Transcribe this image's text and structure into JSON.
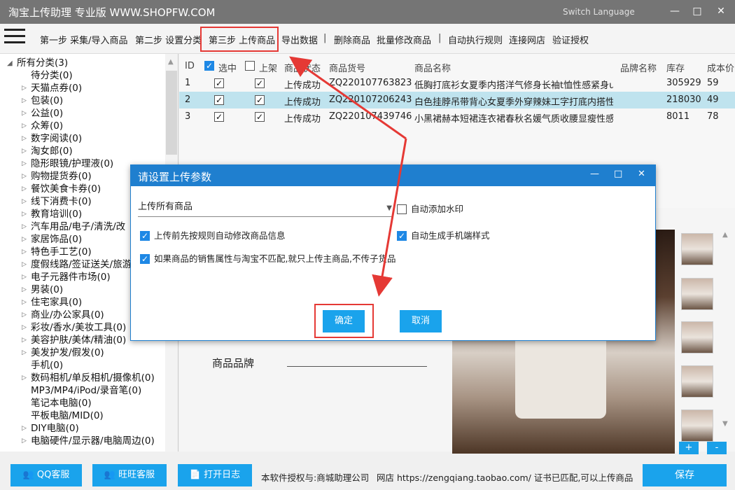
{
  "window": {
    "title": "淘宝上传助理 专业版 WWW.SHOPFW.COM",
    "language_label": "Switch Language",
    "minimize": "—",
    "maximize": "□",
    "close": "✕"
  },
  "menu": {
    "items": [
      "第一步 采集/导入商品",
      "第二步 设置分类",
      "第三步 上传商品",
      "导出数据",
      "|",
      "删除商品",
      "批量修改商品",
      "|",
      "自动执行规则",
      "连接网店",
      "验证授权"
    ]
  },
  "tree": {
    "root": "所有分类(3)",
    "items": [
      {
        "label": "待分类(0)",
        "arrow": false
      },
      {
        "label": "天猫点券(0)",
        "arrow": true
      },
      {
        "label": "包装(0)",
        "arrow": true
      },
      {
        "label": "公益(0)",
        "arrow": true
      },
      {
        "label": "众筹(0)",
        "arrow": true
      },
      {
        "label": "数字阅读(0)",
        "arrow": true
      },
      {
        "label": "淘女郎(0)",
        "arrow": true
      },
      {
        "label": "隐形眼镜/护理液(0)",
        "arrow": true
      },
      {
        "label": "购物提货券(0)",
        "arrow": true
      },
      {
        "label": "餐饮美食卡券(0)",
        "arrow": true
      },
      {
        "label": "线下消费卡(0)",
        "arrow": true
      },
      {
        "label": "教育培训(0)",
        "arrow": true
      },
      {
        "label": "汽车用品/电子/清洗/改",
        "arrow": true
      },
      {
        "label": "家居饰品(0)",
        "arrow": true
      },
      {
        "label": "特色手工艺(0)",
        "arrow": true
      },
      {
        "label": "度假线路/签证送关/旅游",
        "arrow": true
      },
      {
        "label": "电子元器件市场(0)",
        "arrow": true
      },
      {
        "label": "男装(0)",
        "arrow": true
      },
      {
        "label": "住宅家具(0)",
        "arrow": true
      },
      {
        "label": "商业/办公家具(0)",
        "arrow": true
      },
      {
        "label": "彩妆/香水/美妆工具(0)",
        "arrow": true
      },
      {
        "label": "美容护肤/美体/精油(0)",
        "arrow": true
      },
      {
        "label": "美发护发/假发(0)",
        "arrow": true
      },
      {
        "label": "手机(0)",
        "arrow": false
      },
      {
        "label": "数码相机/单反相机/摄像机(0)",
        "arrow": true
      },
      {
        "label": "MP3/MP4/iPod/录音笔(0)",
        "arrow": false
      },
      {
        "label": "笔记本电脑(0)",
        "arrow": false
      },
      {
        "label": "平板电脑/MID(0)",
        "arrow": false
      },
      {
        "label": "DIY电脑(0)",
        "arrow": true
      },
      {
        "label": "电脑硬件/显示器/电脑周边(0)",
        "arrow": true
      }
    ]
  },
  "grid": {
    "headers": {
      "id": "ID",
      "selected": "选中",
      "listed": "上架",
      "status": "商品状态",
      "sku": "商品货号",
      "name": "商品名称",
      "brand": "品牌名称",
      "stock": "库存",
      "cost": "成本价"
    },
    "rows": [
      {
        "id": "1",
        "status": "上传成功",
        "sku": "ZQ220107763823",
        "name": "低胸打底衫女夏季内搭洋气修身长袖t恤性感紧身u",
        "brand": "",
        "stock": "305929",
        "cost": "59"
      },
      {
        "id": "2",
        "status": "上传成功",
        "sku": "ZQ220107206243",
        "name": "白色挂脖吊带背心女夏季外穿辣妹工字打底内搭性",
        "brand": "",
        "stock": "218030",
        "cost": "49"
      },
      {
        "id": "3",
        "status": "上传成功",
        "sku": "ZQ220107439746",
        "name": "小黑裙赫本短裙连衣裙春秋名媛气质收腰显瘦性感",
        "brand": "",
        "stock": "8011",
        "cost": "78"
      }
    ]
  },
  "detail": {
    "brand_label": "商品品牌",
    "add_button": "+",
    "remove_button": "-"
  },
  "dialog": {
    "title": "请设置上传参数",
    "select_value": "上传所有商品",
    "opt_watermark": "自动添加水印",
    "opt_rule_modify": "上传前先按规则自动修改商品信息",
    "opt_mobile": "自动生成手机端样式",
    "opt_main_only": "如果商品的销售属性与淘宝不匹配,就只上传主商品,不传子货品",
    "ok": "确定",
    "cancel": "取消"
  },
  "bottom": {
    "qq": "QQ客服",
    "wangwang": "旺旺客服",
    "log": "打开日志",
    "license": "本软件授权与:商城助理公司",
    "shop": "网店 https://zengqiang.taobao.com/ 证书已匹配,可以上传商品",
    "save": "保存"
  },
  "colors": {
    "accent": "#1aa3ec",
    "dialog_header": "#1f7fcf",
    "highlight": "#e53935",
    "selected_row": "#bfe3ee"
  }
}
